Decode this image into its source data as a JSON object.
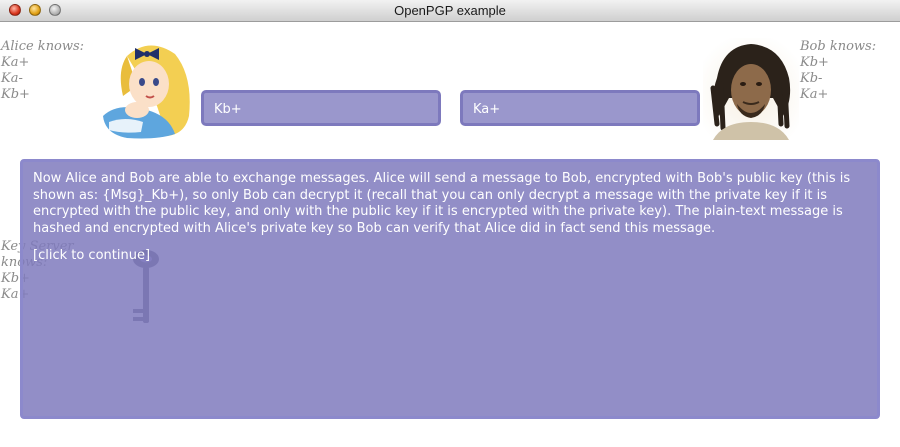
{
  "window": {
    "title": "OpenPGP example"
  },
  "alice": {
    "heading": "Alice knows:",
    "keys": [
      "Ka+",
      "Ka-",
      "Kb+"
    ],
    "box_value": "Kb+"
  },
  "bob": {
    "heading": "Bob knows:",
    "keys": [
      "Kb+",
      "Kb-",
      "Ka+"
    ],
    "box_value": "Ka+"
  },
  "keyserver": {
    "heading_line1": "Key Server",
    "heading_line2": "knows:",
    "keys": [
      "Kb+",
      "Ka+"
    ]
  },
  "message": {
    "text": "Now Alice and Bob are able to exchange messages. Alice will send a message to Bob, encrypted with Bob's public key (this is shown as: {Msg}_Kb+), so only Bob can decrypt it (recall that you can only decrypt a message with the private key if it is encrypted with the public key, and only with the public key if it is encrypted with the private key). The plain-text message is hashed and encrypted with Alice's private key so Bob can verify that Alice did in fact send this message.",
    "continue_label": "[click to continue]"
  },
  "icons": {
    "alice_portrait": "alice-cartoon",
    "bob_portrait": "bob-photo",
    "key": "key-icon"
  },
  "colors": {
    "panel": "#8c89c4",
    "panel_border": "#7d79bd",
    "muted_text": "#8a8a8a"
  }
}
